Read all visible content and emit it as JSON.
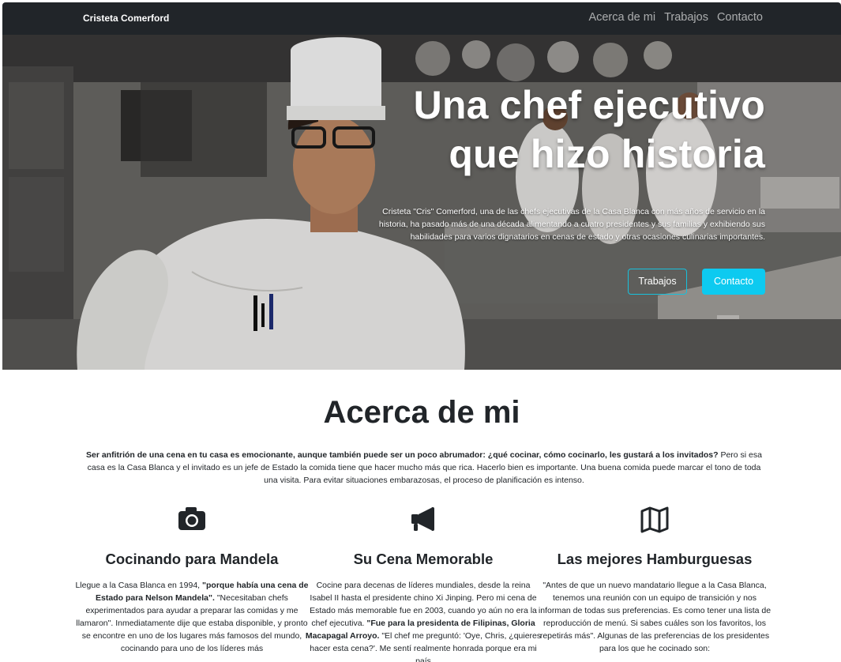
{
  "navbar": {
    "brand": "Cristeta Comerford",
    "links": [
      "Acerca de mi",
      "Trabajos",
      "Contacto"
    ]
  },
  "hero": {
    "title_line1": "Una chef ejecutivo",
    "title_line2": "que hizo historia",
    "lead": "Cristeta \"Cris\" Comerford, una de las chefs ejecutivas de la Casa Blanca con más años de servicio en la historia, ha pasado más de una década alimentando a cuatro presidentes y sus familias y exhibiendo sus habilidades para varios dignatarios en cenas de estado y otras ocasiones culinarias importantes.",
    "button_outline": "Trabajos",
    "button_solid": "Contacto"
  },
  "about": {
    "title": "Acerca de mi",
    "lead_bold": "Ser anfitrión de una cena en tu casa es emocionante, aunque también puede ser un poco abrumador: ¿qué cocinar, cómo cocinarlo, les gustará a los invitados?",
    "lead_rest": " Pero si esa casa es la Casa Blanca y el invitado es un jefe de Estado la comida tiene que hacer mucho más que rica. Hacerlo bien es importante. Una buena comida puede marcar el tono de toda una visita. Para evitar situaciones embarazosas, el proceso de planificación es intenso."
  },
  "columns": [
    {
      "icon": "camera-icon",
      "title": "Cocinando para Mandela",
      "text_a": "Llegue a la Casa Blanca en 1994, ",
      "text_bold": "\"porque había una cena de Estado para Nelson Mandela\".",
      "text_b": " \"Necesitaban chefs experimentados para ayudar a preparar las comidas y me llamaron\". Inmediatamente dije que estaba disponible, y pronto se encontre en uno de los lugares más famosos del mundo, cocinando para uno de los líderes más"
    },
    {
      "icon": "megaphone-icon",
      "title": "Su Cena Memorable",
      "text_a": "Cocine para decenas de líderes mundiales, desde la reina Isabel II hasta el presidente chino Xi Jinping. Pero mi cena de Estado más memorable fue en 2003, cuando yo aún no era la chef ejecutiva. ",
      "text_bold": "\"Fue para la presidenta de Filipinas, Gloria Macapagal Arroyo.",
      "text_b": " \"El chef me preguntó: 'Oye, Chris, ¿quieres hacer esta cena?'. Me sentí realmente honrada porque era mi país"
    },
    {
      "icon": "map-icon",
      "title": "Las mejores Hamburguesas",
      "text_a": "\"Antes de que un nuevo mandatario llegue a la Casa Blanca, tenemos una reunión con un equipo de transición y nos informan de todas sus preferencias. Es como tener una lista de reproducción de menú. Si sabes cuáles son los favoritos, los repetirás más\". Algunas de las preferencias de los presidentes para los que he cocinado son:",
      "text_bold": "",
      "text_b": ""
    }
  ],
  "colors": {
    "navbar_bg": "#212529",
    "accent_cyan": "#0dcaf0",
    "text_dark": "#212529"
  }
}
